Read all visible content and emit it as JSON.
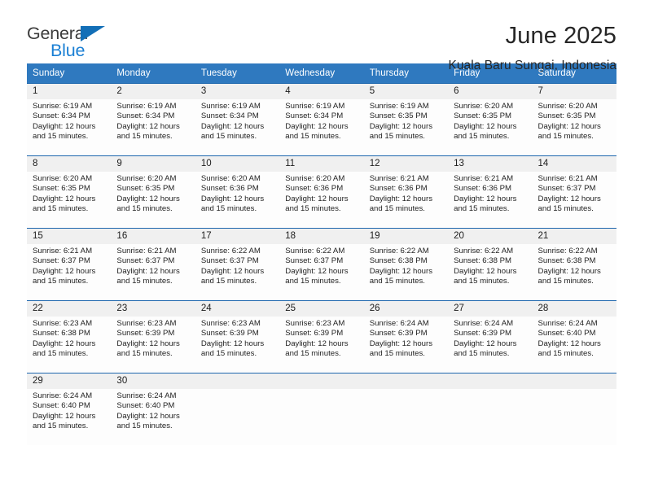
{
  "logo": {
    "line1": "General",
    "line2": "Blue",
    "triangle_color": "#136fb7",
    "text_color": "#3b3b3b",
    "blue_color": "#1a7fd4"
  },
  "header": {
    "month_title": "June 2025",
    "location": "Kuala Baru Sungai, Indonesia"
  },
  "theme": {
    "header_bg": "#2f79bf",
    "header_text": "#ffffff",
    "row_divider": "#1d66ad",
    "daynum_bg": "#f0f0f0"
  },
  "weekdays": [
    "Sunday",
    "Monday",
    "Tuesday",
    "Wednesday",
    "Thursday",
    "Friday",
    "Saturday"
  ],
  "weeks": [
    {
      "days": [
        {
          "num": "1",
          "sunrise": "Sunrise: 6:19 AM",
          "sunset": "Sunset: 6:34 PM",
          "daylight": "Daylight: 12 hours and 15 minutes."
        },
        {
          "num": "2",
          "sunrise": "Sunrise: 6:19 AM",
          "sunset": "Sunset: 6:34 PM",
          "daylight": "Daylight: 12 hours and 15 minutes."
        },
        {
          "num": "3",
          "sunrise": "Sunrise: 6:19 AM",
          "sunset": "Sunset: 6:34 PM",
          "daylight": "Daylight: 12 hours and 15 minutes."
        },
        {
          "num": "4",
          "sunrise": "Sunrise: 6:19 AM",
          "sunset": "Sunset: 6:34 PM",
          "daylight": "Daylight: 12 hours and 15 minutes."
        },
        {
          "num": "5",
          "sunrise": "Sunrise: 6:19 AM",
          "sunset": "Sunset: 6:35 PM",
          "daylight": "Daylight: 12 hours and 15 minutes."
        },
        {
          "num": "6",
          "sunrise": "Sunrise: 6:20 AM",
          "sunset": "Sunset: 6:35 PM",
          "daylight": "Daylight: 12 hours and 15 minutes."
        },
        {
          "num": "7",
          "sunrise": "Sunrise: 6:20 AM",
          "sunset": "Sunset: 6:35 PM",
          "daylight": "Daylight: 12 hours and 15 minutes."
        }
      ]
    },
    {
      "days": [
        {
          "num": "8",
          "sunrise": "Sunrise: 6:20 AM",
          "sunset": "Sunset: 6:35 PM",
          "daylight": "Daylight: 12 hours and 15 minutes."
        },
        {
          "num": "9",
          "sunrise": "Sunrise: 6:20 AM",
          "sunset": "Sunset: 6:35 PM",
          "daylight": "Daylight: 12 hours and 15 minutes."
        },
        {
          "num": "10",
          "sunrise": "Sunrise: 6:20 AM",
          "sunset": "Sunset: 6:36 PM",
          "daylight": "Daylight: 12 hours and 15 minutes."
        },
        {
          "num": "11",
          "sunrise": "Sunrise: 6:20 AM",
          "sunset": "Sunset: 6:36 PM",
          "daylight": "Daylight: 12 hours and 15 minutes."
        },
        {
          "num": "12",
          "sunrise": "Sunrise: 6:21 AM",
          "sunset": "Sunset: 6:36 PM",
          "daylight": "Daylight: 12 hours and 15 minutes."
        },
        {
          "num": "13",
          "sunrise": "Sunrise: 6:21 AM",
          "sunset": "Sunset: 6:36 PM",
          "daylight": "Daylight: 12 hours and 15 minutes."
        },
        {
          "num": "14",
          "sunrise": "Sunrise: 6:21 AM",
          "sunset": "Sunset: 6:37 PM",
          "daylight": "Daylight: 12 hours and 15 minutes."
        }
      ]
    },
    {
      "days": [
        {
          "num": "15",
          "sunrise": "Sunrise: 6:21 AM",
          "sunset": "Sunset: 6:37 PM",
          "daylight": "Daylight: 12 hours and 15 minutes."
        },
        {
          "num": "16",
          "sunrise": "Sunrise: 6:21 AM",
          "sunset": "Sunset: 6:37 PM",
          "daylight": "Daylight: 12 hours and 15 minutes."
        },
        {
          "num": "17",
          "sunrise": "Sunrise: 6:22 AM",
          "sunset": "Sunset: 6:37 PM",
          "daylight": "Daylight: 12 hours and 15 minutes."
        },
        {
          "num": "18",
          "sunrise": "Sunrise: 6:22 AM",
          "sunset": "Sunset: 6:37 PM",
          "daylight": "Daylight: 12 hours and 15 minutes."
        },
        {
          "num": "19",
          "sunrise": "Sunrise: 6:22 AM",
          "sunset": "Sunset: 6:38 PM",
          "daylight": "Daylight: 12 hours and 15 minutes."
        },
        {
          "num": "20",
          "sunrise": "Sunrise: 6:22 AM",
          "sunset": "Sunset: 6:38 PM",
          "daylight": "Daylight: 12 hours and 15 minutes."
        },
        {
          "num": "21",
          "sunrise": "Sunrise: 6:22 AM",
          "sunset": "Sunset: 6:38 PM",
          "daylight": "Daylight: 12 hours and 15 minutes."
        }
      ]
    },
    {
      "days": [
        {
          "num": "22",
          "sunrise": "Sunrise: 6:23 AM",
          "sunset": "Sunset: 6:38 PM",
          "daylight": "Daylight: 12 hours and 15 minutes."
        },
        {
          "num": "23",
          "sunrise": "Sunrise: 6:23 AM",
          "sunset": "Sunset: 6:39 PM",
          "daylight": "Daylight: 12 hours and 15 minutes."
        },
        {
          "num": "24",
          "sunrise": "Sunrise: 6:23 AM",
          "sunset": "Sunset: 6:39 PM",
          "daylight": "Daylight: 12 hours and 15 minutes."
        },
        {
          "num": "25",
          "sunrise": "Sunrise: 6:23 AM",
          "sunset": "Sunset: 6:39 PM",
          "daylight": "Daylight: 12 hours and 15 minutes."
        },
        {
          "num": "26",
          "sunrise": "Sunrise: 6:24 AM",
          "sunset": "Sunset: 6:39 PM",
          "daylight": "Daylight: 12 hours and 15 minutes."
        },
        {
          "num": "27",
          "sunrise": "Sunrise: 6:24 AM",
          "sunset": "Sunset: 6:39 PM",
          "daylight": "Daylight: 12 hours and 15 minutes."
        },
        {
          "num": "28",
          "sunrise": "Sunrise: 6:24 AM",
          "sunset": "Sunset: 6:40 PM",
          "daylight": "Daylight: 12 hours and 15 minutes."
        }
      ]
    },
    {
      "days": [
        {
          "num": "29",
          "sunrise": "Sunrise: 6:24 AM",
          "sunset": "Sunset: 6:40 PM",
          "daylight": "Daylight: 12 hours and 15 minutes."
        },
        {
          "num": "30",
          "sunrise": "Sunrise: 6:24 AM",
          "sunset": "Sunset: 6:40 PM",
          "daylight": "Daylight: 12 hours and 15 minutes."
        },
        {
          "num": "",
          "sunrise": "",
          "sunset": "",
          "daylight": ""
        },
        {
          "num": "",
          "sunrise": "",
          "sunset": "",
          "daylight": ""
        },
        {
          "num": "",
          "sunrise": "",
          "sunset": "",
          "daylight": ""
        },
        {
          "num": "",
          "sunrise": "",
          "sunset": "",
          "daylight": ""
        },
        {
          "num": "",
          "sunrise": "",
          "sunset": "",
          "daylight": ""
        }
      ]
    }
  ]
}
